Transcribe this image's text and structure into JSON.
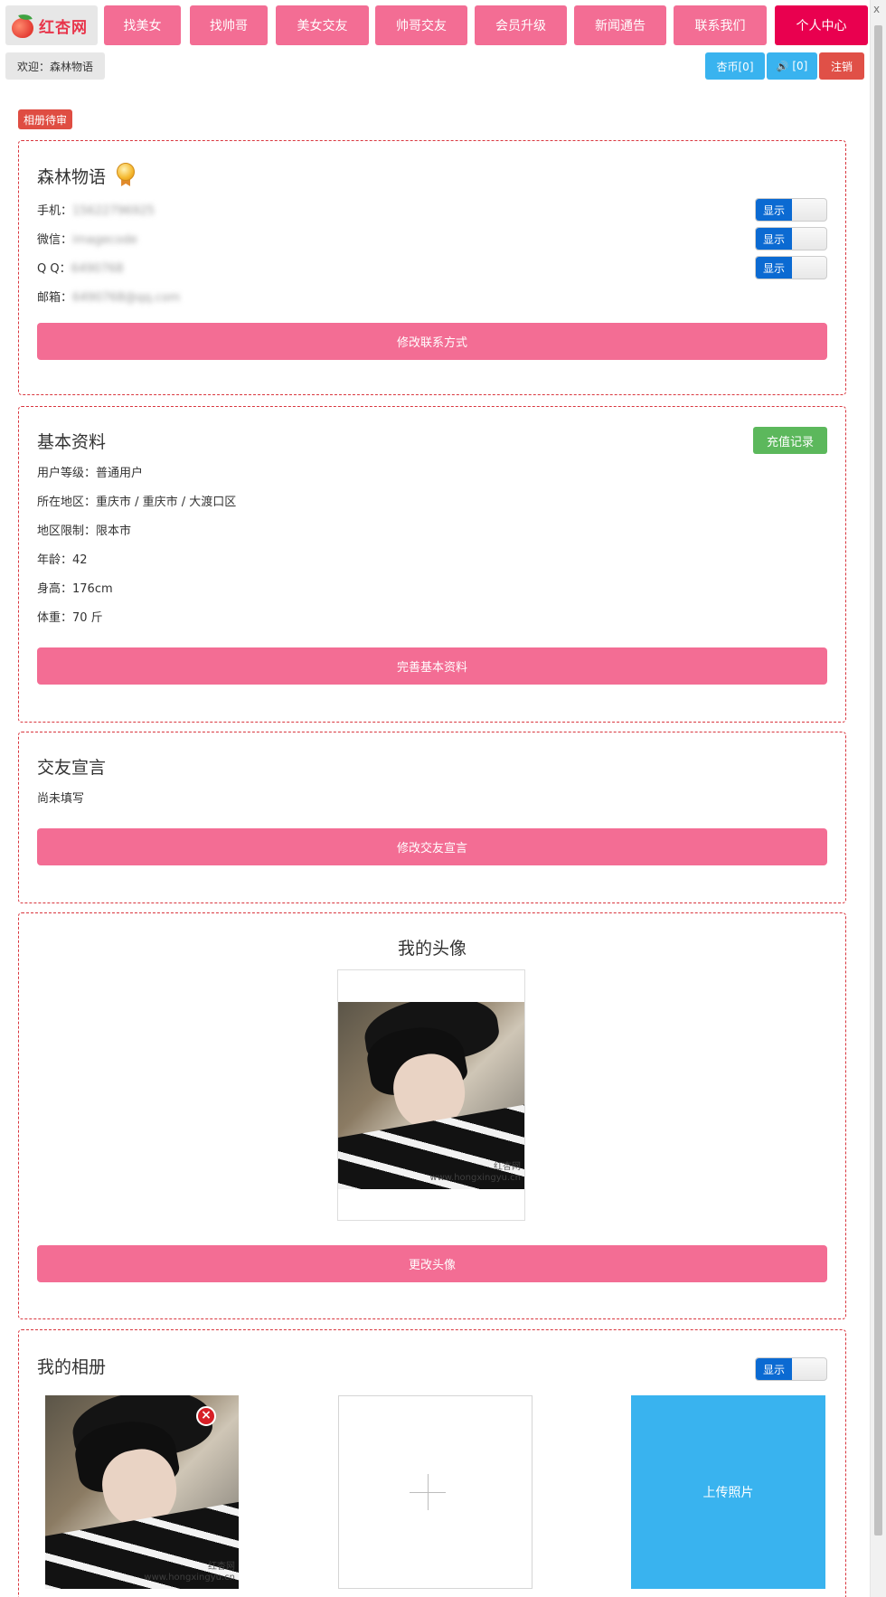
{
  "brand": {
    "name": "红杏网"
  },
  "nav": {
    "items": [
      {
        "label": "找美女"
      },
      {
        "label": "找帅哥"
      },
      {
        "label": "美女交友"
      },
      {
        "label": "帅哥交友"
      },
      {
        "label": "会员升级"
      },
      {
        "label": "新闻通告"
      },
      {
        "label": "联系我们"
      },
      {
        "label": "个人中心"
      }
    ]
  },
  "header": {
    "welcome": "欢迎：森林物语",
    "coins": "杏币[0]",
    "messages": "[0]",
    "logout": "注销",
    "close": "x"
  },
  "album_status": "相册待审",
  "contact": {
    "title": "森林物语",
    "phone": {
      "label": "手机：",
      "value": "15622796925"
    },
    "wechat": {
      "label": "微信：",
      "value": "imagecode"
    },
    "qq": {
      "label": "Q Q：",
      "value": "6490768"
    },
    "email": {
      "label": "邮箱：",
      "value": "6490768@qq.com"
    },
    "toggle_label": "显示",
    "edit_button": "修改联系方式"
  },
  "basic": {
    "title": "基本资料",
    "recharge_button": "充值记录",
    "lines": [
      "用户等级：普通用户",
      "所在地区：重庆市 / 重庆市 / 大渡口区",
      "地区限制：限本市",
      "年龄：42",
      "身高：176cm",
      "体重：70 斤"
    ],
    "edit_button": "完善基本资料"
  },
  "declaration": {
    "title": "交友宣言",
    "text": "尚未填写",
    "edit_button": "修改交友宣言"
  },
  "avatar": {
    "title": "我的头像",
    "watermark": "红杏网\nwww.hongxingyu.cn",
    "change_button": "更改头像"
  },
  "album": {
    "title": "我的相册",
    "toggle_label": "显示",
    "upload_label": "上传照片",
    "photo_watermark": "红杏网\nwww.hongxingyu.cn"
  },
  "colors": {
    "nav_pink": "#f36d94",
    "nav_active": "#e9004f",
    "blue": "#39b3ef",
    "red": "#e05047",
    "toggle_blue": "#0b6ad2",
    "green": "#5cb85c",
    "dashed_border": "#d9363e"
  }
}
